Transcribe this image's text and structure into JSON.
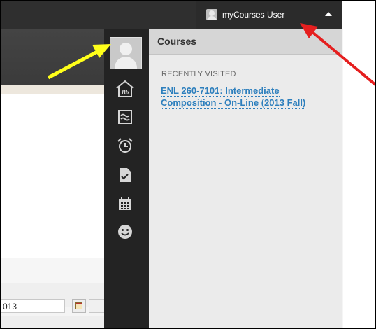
{
  "user_menu": {
    "label": "myCourses User",
    "avatar_icon": "user-avatar-icon",
    "caret_icon": "caret-up-icon"
  },
  "iconbar": {
    "items": [
      {
        "name": "profile",
        "icon": "user-avatar-icon"
      },
      {
        "name": "home",
        "icon": "home-bb-icon"
      },
      {
        "name": "updates",
        "icon": "stream-waves-icon"
      },
      {
        "name": "due-dates",
        "icon": "alarm-clock-icon"
      },
      {
        "name": "grades",
        "icon": "document-check-icon"
      },
      {
        "name": "calendar",
        "icon": "calendar-grid-icon"
      },
      {
        "name": "people",
        "icon": "smiley-icon"
      }
    ]
  },
  "panel": {
    "title": "Courses",
    "section_label": "RECENTLY VISITED",
    "course_line1": "ENL 260-7101: Intermediate",
    "course_line2": "Composition - On-Line (2013 Fall)"
  },
  "page": {
    "date_value": "013"
  },
  "colors": {
    "accent_link": "#2d7fbd",
    "topbar": "#2f2f2f",
    "iconbar": "#232323",
    "arrow_yellow": "#ffff1a",
    "arrow_red": "#e51f1f"
  }
}
